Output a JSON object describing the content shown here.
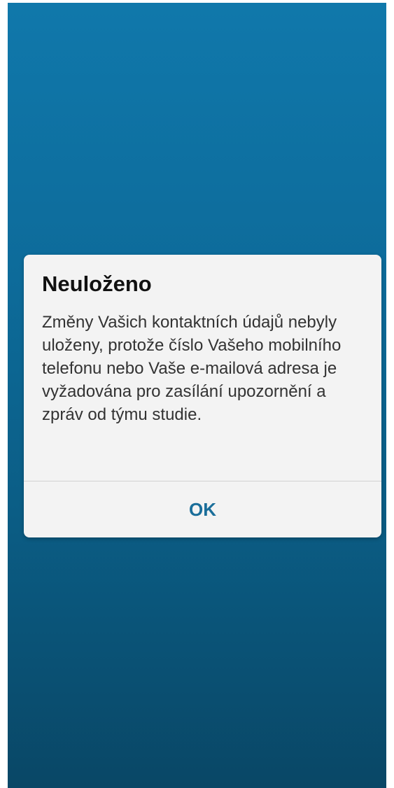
{
  "dialog": {
    "title": "Neuloženo",
    "message": "Změny Vašich kontaktních údajů nebyly uloženy, protože číslo Vašeho mobilního telefonu nebo Vaše e-mailová adresa je vyžadována pro zasílání upozornění a zpráv od týmu studie.",
    "ok_label": "OK"
  },
  "colors": {
    "background_top": "#1078ab",
    "background_bottom": "#094766",
    "dialog_background": "#f3f3f3",
    "accent": "#1a6e9a"
  }
}
